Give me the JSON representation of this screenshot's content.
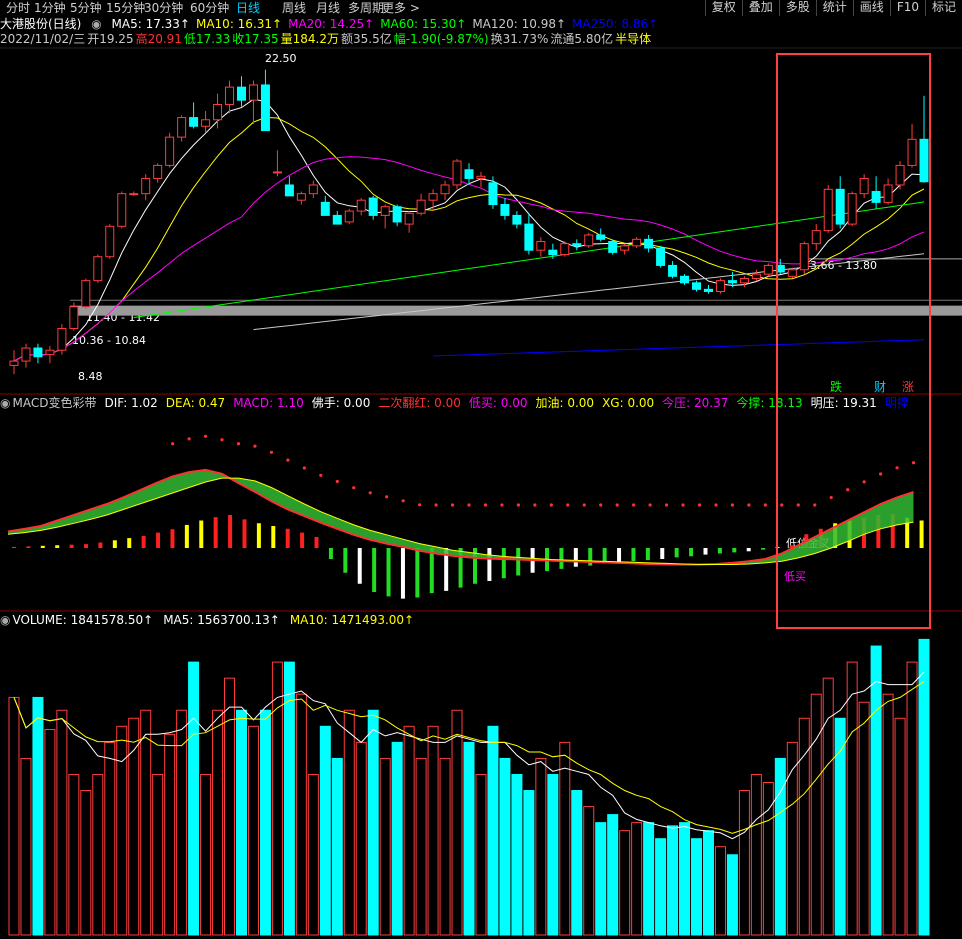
{
  "tabs": [
    "分时",
    "1分钟",
    "5分钟",
    "15分钟",
    "30分钟",
    "60分钟",
    "日线",
    "周线",
    "月线",
    "多周期",
    "更多 >"
  ],
  "active_tab": "日线",
  "toolbar_right": [
    "复权",
    "叠加",
    "多股",
    "统计",
    "画线",
    "F10",
    "标记"
  ],
  "header": {
    "title": "大港股份(日线)",
    "ma": [
      {
        "label": "MA5: 17.33",
        "color": "#ffffff"
      },
      {
        "label": "MA10: 16.31",
        "color": "#ffff00"
      },
      {
        "label": "MA20: 14.25",
        "color": "#ff00ff"
      },
      {
        "label": "MA60: 15.30",
        "color": "#00ff00"
      },
      {
        "label": "MA120: 10.98",
        "color": "#c8c8c8"
      },
      {
        "label": "MA250: 8.86",
        "color": "#0000ff"
      }
    ],
    "info": [
      {
        "text": "2022/11/02/三",
        "color": "#c8c8c8"
      },
      {
        "text": "开19.25",
        "color": "#c8c8c8"
      },
      {
        "text": "高20.91",
        "color": "#ff3232"
      },
      {
        "text": "低17.33",
        "color": "#00ff00"
      },
      {
        "text": "收17.35",
        "color": "#00ff00"
      },
      {
        "text": "量184.2万",
        "color": "#ffff00"
      },
      {
        "text": "额35.5亿",
        "color": "#c8c8c8"
      },
      {
        "text": "幅-1.90(-9.87%)",
        "color": "#00ff00"
      },
      {
        "text": "换31.73%",
        "color": "#c8c8c8"
      },
      {
        "text": "流通5.80亿",
        "color": "#c8c8c8"
      },
      {
        "text": "半导体",
        "color": "#ffff00"
      }
    ]
  },
  "price_annotations": {
    "high": "22.50",
    "low": "8.48",
    "band1": "11.40 - 11.42",
    "band2": "10.36 - 10.84",
    "band3": "13.66 - 13.80"
  },
  "signal_labels": [
    {
      "text": "跌",
      "color": "#00ff00"
    },
    {
      "text": "财",
      "color": "#00d0ff"
    },
    {
      "text": "涨",
      "color": "#ff3232"
    }
  ],
  "macd_header": [
    {
      "text": "MACD变色彩带",
      "color": "#c8c8c8"
    },
    {
      "text": "DIF: 1.02",
      "color": "#ffffff"
    },
    {
      "text": "DEA: 0.47",
      "color": "#ffff00"
    },
    {
      "text": "MACD: 1.10",
      "color": "#ff00ff"
    },
    {
      "text": "佛手: 0.00",
      "color": "#ffffff"
    },
    {
      "text": "二次翻红: 0.00",
      "color": "#ff3232"
    },
    {
      "text": "低买: 0.00",
      "color": "#ff00ff"
    },
    {
      "text": "加油: 0.00",
      "color": "#ffff00"
    },
    {
      "text": "XG: 0.00",
      "color": "#ffff00"
    },
    {
      "text": "今压: 20.37",
      "color": "#ff00ff"
    },
    {
      "text": "今撑: 18.13",
      "color": "#00ff00"
    },
    {
      "text": "明压: 19.31",
      "color": "#ffffff"
    },
    {
      "text": "明撑",
      "color": "#0000ff"
    }
  ],
  "macd_labels": {
    "golden": "低位金叉",
    "lowbuy": "低买"
  },
  "volume_header": [
    {
      "text": "VOLUME: 1841578.50",
      "color": "#ffffff"
    },
    {
      "text": "MA5: 1563700.13",
      "color": "#ffffff"
    },
    {
      "text": "MA10: 1471493.00",
      "color": "#ffff00"
    }
  ],
  "chart_data": [
    {
      "type": "candlestick",
      "title": "大港股份(日线)",
      "ylim": [
        8,
        23.5
      ],
      "candles": [
        {
          "o": 8.9,
          "h": 9.6,
          "l": 8.5,
          "c": 9.1
        },
        {
          "o": 9.1,
          "h": 9.9,
          "l": 8.8,
          "c": 9.7
        },
        {
          "o": 9.7,
          "h": 9.9,
          "l": 9.0,
          "c": 9.3
        },
        {
          "o": 9.4,
          "h": 9.8,
          "l": 9.0,
          "c": 9.6
        },
        {
          "o": 9.6,
          "h": 10.8,
          "l": 9.4,
          "c": 10.6
        },
        {
          "o": 10.6,
          "h": 11.8,
          "l": 10.5,
          "c": 11.6
        },
        {
          "o": 11.6,
          "h": 12.9,
          "l": 11.5,
          "c": 12.8
        },
        {
          "o": 12.8,
          "h": 14.0,
          "l": 12.7,
          "c": 13.9
        },
        {
          "o": 13.9,
          "h": 15.4,
          "l": 13.8,
          "c": 15.3
        },
        {
          "o": 15.3,
          "h": 16.9,
          "l": 15.2,
          "c": 16.8
        },
        {
          "o": 16.8,
          "h": 16.9,
          "l": 16.7,
          "c": 16.8
        },
        {
          "o": 16.8,
          "h": 17.7,
          "l": 16.5,
          "c": 17.5
        },
        {
          "o": 17.5,
          "h": 18.2,
          "l": 17.3,
          "c": 18.1
        },
        {
          "o": 18.1,
          "h": 19.6,
          "l": 18.0,
          "c": 19.4
        },
        {
          "o": 19.4,
          "h": 20.4,
          "l": 19.2,
          "c": 20.3
        },
        {
          "o": 20.3,
          "h": 21.0,
          "l": 19.8,
          "c": 19.9
        },
        {
          "o": 19.9,
          "h": 20.6,
          "l": 19.6,
          "c": 20.2
        },
        {
          "o": 20.2,
          "h": 21.4,
          "l": 19.8,
          "c": 20.9
        },
        {
          "o": 20.9,
          "h": 22.0,
          "l": 20.5,
          "c": 21.7
        },
        {
          "o": 21.7,
          "h": 22.2,
          "l": 20.8,
          "c": 21.1
        },
        {
          "o": 21.1,
          "h": 22.0,
          "l": 20.0,
          "c": 21.8
        },
        {
          "o": 21.8,
          "h": 22.5,
          "l": 19.7,
          "c": 19.7
        },
        {
          "o": 17.8,
          "h": 18.8,
          "l": 17.6,
          "c": 17.8
        },
        {
          "o": 17.2,
          "h": 17.6,
          "l": 16.7,
          "c": 16.7
        },
        {
          "o": 16.5,
          "h": 16.9,
          "l": 16.3,
          "c": 16.8
        },
        {
          "o": 16.8,
          "h": 17.4,
          "l": 16.6,
          "c": 17.2
        },
        {
          "o": 16.4,
          "h": 16.7,
          "l": 15.8,
          "c": 15.8
        },
        {
          "o": 15.8,
          "h": 16.0,
          "l": 15.4,
          "c": 15.4
        },
        {
          "o": 15.5,
          "h": 16.1,
          "l": 15.4,
          "c": 16.0
        },
        {
          "o": 16.0,
          "h": 16.6,
          "l": 15.8,
          "c": 16.5
        },
        {
          "o": 16.6,
          "h": 16.7,
          "l": 15.6,
          "c": 15.8
        },
        {
          "o": 15.8,
          "h": 16.3,
          "l": 15.2,
          "c": 16.2
        },
        {
          "o": 16.2,
          "h": 16.3,
          "l": 15.3,
          "c": 15.5
        },
        {
          "o": 15.4,
          "h": 16.0,
          "l": 15.0,
          "c": 15.9
        },
        {
          "o": 15.9,
          "h": 16.8,
          "l": 15.8,
          "c": 16.5
        },
        {
          "o": 16.5,
          "h": 17.0,
          "l": 16.0,
          "c": 16.8
        },
        {
          "o": 16.8,
          "h": 17.4,
          "l": 16.5,
          "c": 17.2
        },
        {
          "o": 17.2,
          "h": 18.4,
          "l": 17.0,
          "c": 18.3
        },
        {
          "o": 17.9,
          "h": 18.2,
          "l": 17.2,
          "c": 17.5
        },
        {
          "o": 17.5,
          "h": 17.8,
          "l": 17.1,
          "c": 17.6
        },
        {
          "o": 17.3,
          "h": 17.6,
          "l": 16.1,
          "c": 16.3
        },
        {
          "o": 16.3,
          "h": 16.6,
          "l": 15.6,
          "c": 15.8
        },
        {
          "o": 15.8,
          "h": 16.0,
          "l": 15.2,
          "c": 15.4
        },
        {
          "o": 15.4,
          "h": 15.9,
          "l": 14.0,
          "c": 14.2
        },
        {
          "o": 14.2,
          "h": 14.8,
          "l": 13.9,
          "c": 14.6
        },
        {
          "o": 14.2,
          "h": 14.5,
          "l": 13.8,
          "c": 14.0
        },
        {
          "o": 14.0,
          "h": 14.6,
          "l": 13.9,
          "c": 14.5
        },
        {
          "o": 14.5,
          "h": 14.7,
          "l": 14.2,
          "c": 14.4
        },
        {
          "o": 14.4,
          "h": 15.0,
          "l": 14.3,
          "c": 14.9
        },
        {
          "o": 14.9,
          "h": 15.2,
          "l": 14.6,
          "c": 14.7
        },
        {
          "o": 14.6,
          "h": 14.7,
          "l": 14.0,
          "c": 14.1
        },
        {
          "o": 14.2,
          "h": 14.5,
          "l": 14.0,
          "c": 14.4
        },
        {
          "o": 14.4,
          "h": 14.8,
          "l": 14.3,
          "c": 14.7
        },
        {
          "o": 14.7,
          "h": 14.9,
          "l": 14.1,
          "c": 14.3
        },
        {
          "o": 14.3,
          "h": 14.4,
          "l": 13.4,
          "c": 13.5
        },
        {
          "o": 13.5,
          "h": 13.7,
          "l": 12.9,
          "c": 13.0
        },
        {
          "o": 13.0,
          "h": 13.1,
          "l": 12.6,
          "c": 12.7
        },
        {
          "o": 12.7,
          "h": 12.8,
          "l": 12.3,
          "c": 12.4
        },
        {
          "o": 12.4,
          "h": 12.6,
          "l": 12.2,
          "c": 12.3
        },
        {
          "o": 12.3,
          "h": 12.9,
          "l": 12.2,
          "c": 12.8
        },
        {
          "o": 12.8,
          "h": 13.2,
          "l": 12.5,
          "c": 12.7
        },
        {
          "o": 12.7,
          "h": 13.0,
          "l": 12.5,
          "c": 12.9
        },
        {
          "o": 12.9,
          "h": 13.3,
          "l": 12.8,
          "c": 13.1
        },
        {
          "o": 13.1,
          "h": 13.6,
          "l": 13.0,
          "c": 13.5
        },
        {
          "o": 13.5,
          "h": 13.8,
          "l": 13.1,
          "c": 13.2
        },
        {
          "o": 13.0,
          "h": 13.4,
          "l": 12.9,
          "c": 13.3
        },
        {
          "o": 13.3,
          "h": 14.6,
          "l": 13.1,
          "c": 14.5
        },
        {
          "o": 14.5,
          "h": 15.4,
          "l": 14.2,
          "c": 15.1
        },
        {
          "o": 15.1,
          "h": 17.2,
          "l": 15.0,
          "c": 17.0
        },
        {
          "o": 17.0,
          "h": 17.6,
          "l": 15.2,
          "c": 15.4
        },
        {
          "o": 15.4,
          "h": 16.9,
          "l": 15.3,
          "c": 16.8
        },
        {
          "o": 16.8,
          "h": 17.7,
          "l": 16.6,
          "c": 17.5
        },
        {
          "o": 16.9,
          "h": 17.6,
          "l": 16.1,
          "c": 16.4
        },
        {
          "o": 16.4,
          "h": 17.5,
          "l": 16.3,
          "c": 17.2
        },
        {
          "o": 17.2,
          "h": 18.3,
          "l": 17.0,
          "c": 18.1
        },
        {
          "o": 18.1,
          "h": 20.0,
          "l": 18.0,
          "c": 19.3
        },
        {
          "o": 19.3,
          "h": 21.3,
          "l": 17.3,
          "c": 17.35
        }
      ],
      "ma_lines": [
        {
          "name": "MA5",
          "color": "#ffffff"
        },
        {
          "name": "MA10",
          "color": "#ffff00"
        },
        {
          "name": "MA20",
          "color": "#ff00ff"
        },
        {
          "name": "MA60",
          "color": "#00ff00"
        },
        {
          "name": "MA120",
          "color": "#c8c8c8"
        },
        {
          "name": "MA250",
          "color": "#0000ff"
        }
      ]
    },
    {
      "type": "bar",
      "title": "MACD变色彩带",
      "ylim": [
        -1.9,
        1.5
      ],
      "values": [
        0.02,
        0.03,
        0.04,
        0.05,
        0.06,
        0.07,
        0.1,
        0.14,
        0.18,
        0.22,
        0.28,
        0.34,
        0.42,
        0.5,
        0.56,
        0.6,
        0.52,
        0.45,
        0.4,
        0.35,
        0.28,
        0.2,
        -0.2,
        -0.45,
        -0.65,
        -0.8,
        -0.88,
        -0.92,
        -0.9,
        -0.82,
        -0.78,
        -0.72,
        -0.65,
        -0.6,
        -0.55,
        -0.5,
        -0.45,
        -0.42,
        -0.38,
        -0.34,
        -0.32,
        -0.28,
        -0.26,
        -0.24,
        -0.22,
        -0.2,
        -0.17,
        -0.15,
        -0.12,
        -0.1,
        -0.08,
        -0.06,
        -0.03,
        0.02,
        0.05,
        0.25,
        0.35,
        0.45,
        0.5,
        0.55,
        0.6,
        0.62,
        0.55,
        0.5
      ],
      "dif": [
        0.3,
        0.35,
        0.4,
        0.5,
        0.6,
        0.7,
        0.8,
        0.92,
        1.05,
        1.18,
        1.3,
        1.38,
        1.42,
        1.35,
        1.18,
        1.02,
        0.85,
        0.7,
        0.58,
        0.46,
        0.35,
        0.24,
        0.15,
        0.08,
        0.02,
        -0.05,
        -0.1,
        -0.14,
        -0.17,
        -0.19,
        -0.2,
        -0.21,
        -0.22,
        -0.23,
        -0.24,
        -0.25,
        -0.26,
        -0.27,
        -0.28,
        -0.29,
        -0.3,
        -0.3,
        -0.3,
        -0.29,
        -0.27,
        -0.24,
        -0.2,
        -0.1,
        0.05,
        0.2,
        0.35,
        0.5,
        0.65,
        0.8,
        0.92,
        1.02
      ],
      "dea": [
        0.25,
        0.28,
        0.32,
        0.38,
        0.45,
        0.52,
        0.6,
        0.7,
        0.8,
        0.9,
        1.0,
        1.1,
        1.2,
        1.27,
        1.27,
        1.22,
        1.1,
        0.95,
        0.8,
        0.66,
        0.54,
        0.42,
        0.32,
        0.24,
        0.16,
        0.08,
        0.02,
        -0.04,
        -0.08,
        -0.12,
        -0.15,
        -0.17,
        -0.19,
        -0.21,
        -0.22,
        -0.23,
        -0.24,
        -0.25,
        -0.26,
        -0.27,
        -0.28,
        -0.29,
        -0.3,
        -0.3,
        -0.3,
        -0.29,
        -0.27,
        -0.24,
        -0.18,
        -0.1,
        0.0,
        0.12,
        0.25,
        0.35,
        0.42,
        0.47
      ]
    },
    {
      "type": "bar",
      "title": "VOLUME",
      "ylim": [
        0,
        1900000
      ],
      "values": [
        1480000,
        1100000,
        1480000,
        1280000,
        1400000,
        1000000,
        900000,
        1000000,
        1200000,
        1300000,
        1350000,
        1400000,
        1000000,
        1250000,
        1400000,
        1700000,
        1000000,
        1400000,
        1600000,
        1400000,
        1300000,
        1400000,
        1700000,
        1700000,
        1500000,
        1000000,
        1300000,
        1100000,
        1400000,
        1200000,
        1400000,
        1100000,
        1200000,
        1300000,
        1100000,
        1300000,
        1100000,
        1400000,
        1200000,
        1000000,
        1300000,
        1100000,
        1000000,
        900000,
        1100000,
        1000000,
        1200000,
        900000,
        800000,
        700000,
        750000,
        650000,
        700000,
        700000,
        600000,
        680000,
        700000,
        600000,
        650000,
        550000,
        500000,
        900000,
        1000000,
        950000,
        1100000,
        1200000,
        1350000,
        1500000,
        1600000,
        1350000,
        1700000,
        1450000,
        1800000,
        1500000,
        1350000,
        1700000,
        1841578
      ]
    }
  ]
}
